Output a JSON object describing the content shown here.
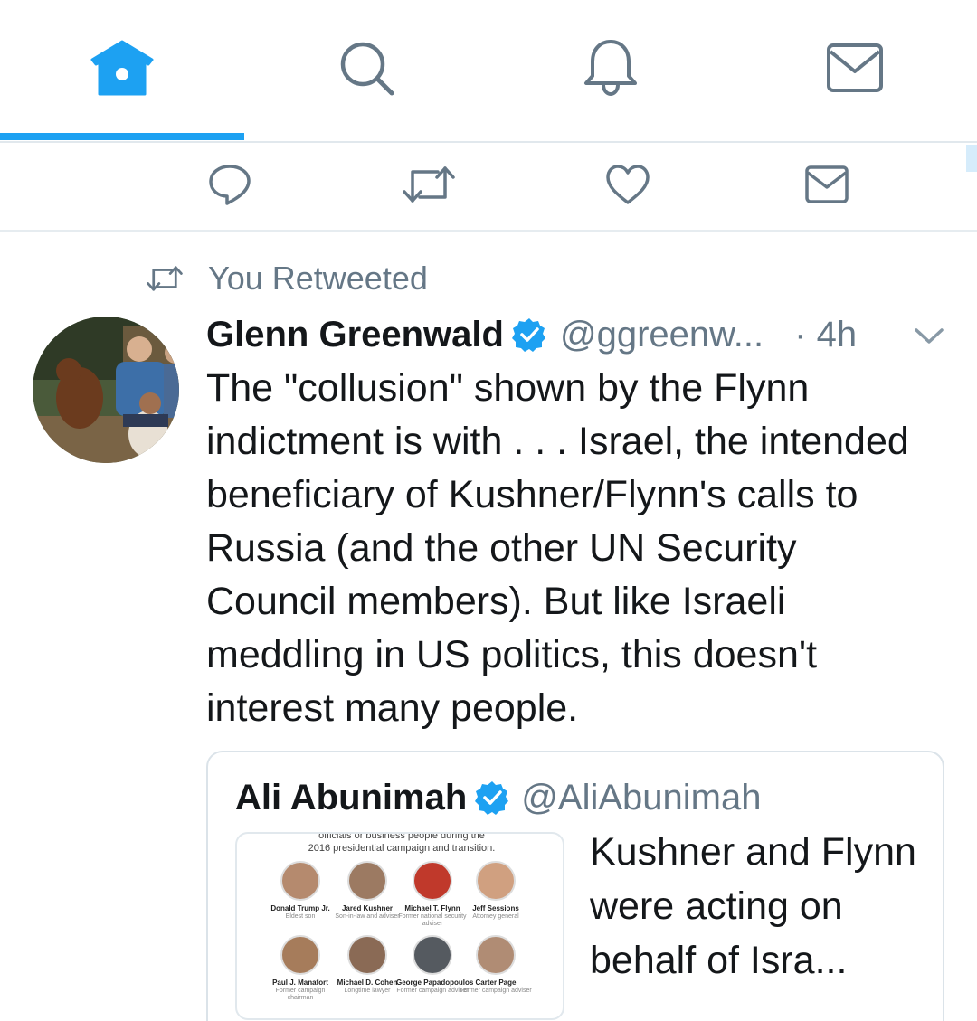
{
  "nav": {
    "tabs": [
      {
        "name": "home",
        "icon": "home-icon",
        "active": true
      },
      {
        "name": "search",
        "icon": "search-icon",
        "active": false
      },
      {
        "name": "notifications",
        "icon": "bell-icon",
        "active": false
      },
      {
        "name": "messages",
        "icon": "mail-icon",
        "active": false
      }
    ],
    "active_color": "#1da1f2",
    "inactive_color": "#657786"
  },
  "prev_tweet_actions": [
    "reply-icon",
    "retweet-icon",
    "like-icon",
    "dm-icon"
  ],
  "tweet": {
    "social_context": "You Retweeted",
    "author_name": "Glenn Greenwald",
    "author_handle": "@ggreenw...",
    "timestamp": "· 4h",
    "text": "The \"collusion\" shown by the Flynn\nindictment is with . . . Israel, the intended\nbeneficiary of Kushner/Flynn's calls to\nRussia (and the other UN Security\nCouncil members). But like Israeli\nmeddling in US politics, this doesn't\ninterest many people."
  },
  "quoted_tweet": {
    "author_name": "Ali Abunimah",
    "author_handle": "@AliAbunimah",
    "text": "Kushner and Flynn were acting on behalf of Isra...",
    "media": {
      "caption_line1": "officials or business people during the",
      "caption_line2": "2016 presidential campaign and transition.",
      "people": [
        {
          "name": "Donald Trump Jr.",
          "role": "Eldest son"
        },
        {
          "name": "Jared Kushner",
          "role": "Son-in-law and adviser"
        },
        {
          "name": "Michael T. Flynn",
          "role": "Former national security adviser"
        },
        {
          "name": "Jeff Sessions",
          "role": "Attorney general"
        },
        {
          "name": "Paul J. Manafort",
          "role": "Former campaign chairman"
        },
        {
          "name": "Michael D. Cohen",
          "role": "Longtime lawyer"
        },
        {
          "name": "George Papadopoulos",
          "role": "Former campaign adviser"
        },
        {
          "name": "Carter Page",
          "role": "Former campaign adviser"
        }
      ]
    }
  },
  "colors": {
    "accent": "#1da1f2",
    "secondary_text": "#657786",
    "primary_text": "#14171a"
  }
}
